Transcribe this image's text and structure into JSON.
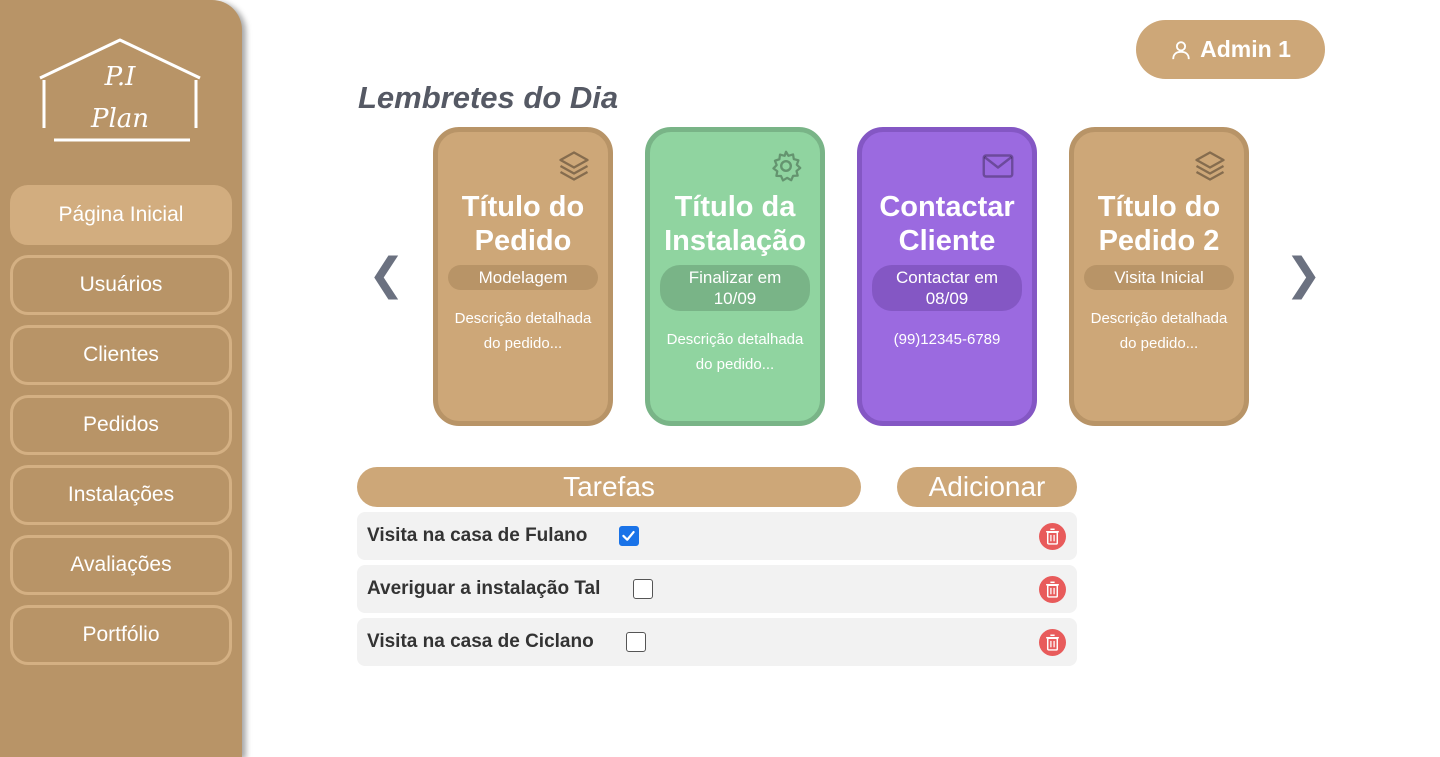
{
  "logo": {
    "line1": "P.I",
    "line2": "Plan"
  },
  "sidebar": {
    "items": [
      {
        "label": "Página Inicial",
        "active": true
      },
      {
        "label": "Usuários"
      },
      {
        "label": "Clientes"
      },
      {
        "label": "Pedidos"
      },
      {
        "label": "Instalações"
      },
      {
        "label": "Avaliações"
      },
      {
        "label": "Portfólio"
      }
    ]
  },
  "header": {
    "user_label": "Admin 1"
  },
  "reminders": {
    "title": "Lembretes do Dia",
    "prev_glyph": "❮",
    "next_glyph": "❯",
    "cards": [
      {
        "title_line1": "Título do",
        "title_line2": "Pedido",
        "tag": "Modelagem",
        "desc": "Descrição detalhada do pedido...",
        "icon": "layers-icon",
        "color": "#cda778",
        "border": "#b89467"
      },
      {
        "title_line1": "Título da",
        "title_line2": "Instalação",
        "tag": "Finalizar em 10/09",
        "desc": "Descrição detalhada do pedido...",
        "icon": "gear-icon",
        "color": "#90d4a0",
        "border": "#79b487"
      },
      {
        "title_line1": "Contactar",
        "title_line2": "Cliente",
        "tag": "Contactar em 08/09",
        "desc": "(99)12345-6789",
        "icon": "mail-icon",
        "color": "#9b6ae0",
        "border": "#8457c4"
      },
      {
        "title_line1": "Título do",
        "title_line2": "Pedido 2",
        "tag": "Visita Inicial",
        "desc": "Descrição detalhada do pedido...",
        "icon": "layers-icon",
        "color": "#cda778",
        "border": "#b89467"
      }
    ]
  },
  "tasks": {
    "header": "Tarefas",
    "add_label": "Adicionar",
    "items": [
      {
        "label": "Visita na casa de Fulano",
        "checked": true
      },
      {
        "label": "Averiguar a instalação Tal",
        "checked": false
      },
      {
        "label": "Visita na casa de Ciclano",
        "checked": false
      }
    ]
  }
}
